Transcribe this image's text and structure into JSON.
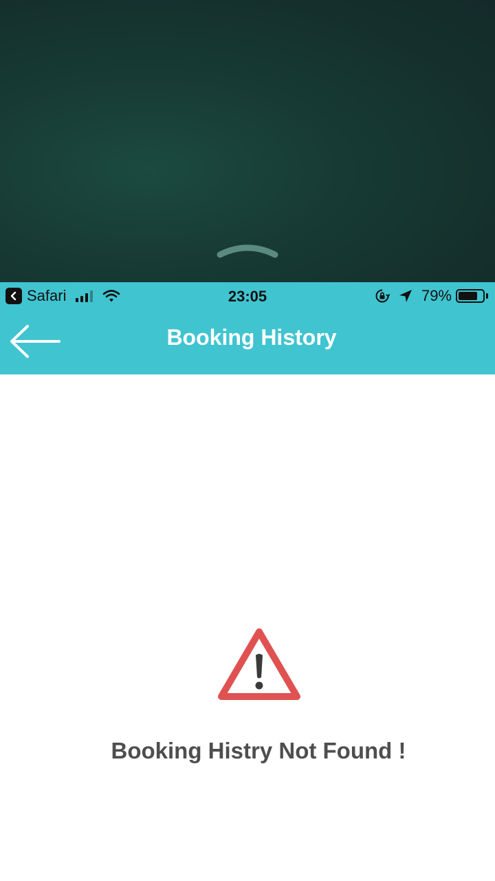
{
  "status_bar": {
    "app_back_label": "Safari",
    "time": "23:05",
    "battery_percent": "79%",
    "battery_level": 0.79,
    "icons": [
      "signal-icon",
      "wifi-icon",
      "rotation-lock-icon",
      "location-arrow-icon",
      "battery-icon"
    ]
  },
  "header": {
    "title": "Booking History",
    "back_icon": "arrow-left-icon",
    "background_color": "#40c4d0"
  },
  "empty_state": {
    "icon": "warning-triangle-icon",
    "message": "Booking Histry Not Found !",
    "icon_color": "#e05252"
  },
  "overlay": {
    "handle_icon": "chevron-up-icon"
  }
}
